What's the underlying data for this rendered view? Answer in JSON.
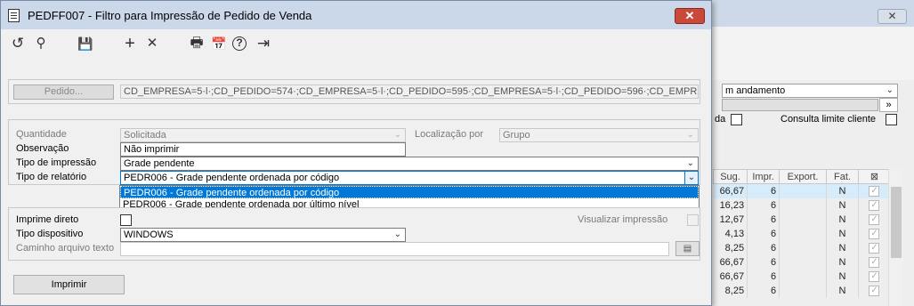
{
  "window": {
    "title": "PEDFF007 - Filtro para Impressão de Pedido de Venda",
    "close_glyph": "✕"
  },
  "toolbar": {
    "icons": [
      "undo-icon",
      "search-icon",
      "save-icon",
      "add-icon",
      "delete-icon",
      "print-icon",
      "calendar-icon",
      "help-icon",
      "exit-icon"
    ],
    "glyphs": [
      "↺",
      "⚲",
      "💾",
      "+",
      "✕",
      "🖶",
      "📅",
      "?",
      "⇥"
    ]
  },
  "pedido": {
    "button_label": "Pedido...",
    "value": "CD_EMPRESA=5·l·;CD_PEDIDO=574·;CD_EMPRESA=5·l·;CD_PEDIDO=595·;CD_EMPRESA=5·l·;CD_PEDIDO=596·;CD_EMPRESA=5·l·;CD"
  },
  "filters": {
    "quantidade_label": "Quantidade",
    "quantidade_value": "Solicitada",
    "localizacao_label": "Localização por",
    "localizacao_value": "Grupo",
    "observacao_label": "Observação",
    "observacao_value": "Não imprimir",
    "tipo_impressao_label": "Tipo de impressão",
    "tipo_impressao_value": "Grade pendente",
    "tipo_relatorio_label": "Tipo de relatório",
    "tipo_relatorio_value": "PEDR006 - Grade pendente ordenada por código",
    "tipo_relatorio_options": [
      "PEDR006 - Grade pendente ordenada por código",
      "PEDR006 - Grade pendente ordenada por último nível"
    ]
  },
  "output": {
    "imprime_direto_label": "Imprime direto",
    "visualizar_label": "Visualizar impressão",
    "tipo_dispositivo_label": "Tipo dispositivo",
    "tipo_dispositivo_value": "WINDOWS",
    "caminho_label": "Caminho arquivo texto",
    "caminho_value": ""
  },
  "actions": {
    "imprimir_label": "Imprimir"
  },
  "background": {
    "close_glyph": "✕",
    "status_select": "m andamento",
    "arrow_button": "»",
    "da_label": "da",
    "consulta_label": "Consulta limite cliente",
    "table_headers": [
      "Sug.",
      "Impr.",
      "Export.",
      "Fat.",
      "⊠"
    ],
    "rows": [
      {
        "sug": "66,67",
        "impr": "6",
        "fat": "N"
      },
      {
        "sug": "16,23",
        "impr": "6",
        "fat": "N"
      },
      {
        "sug": "12,67",
        "impr": "6",
        "fat": "N"
      },
      {
        "sug": "4,13",
        "impr": "6",
        "fat": "N"
      },
      {
        "sug": "8,25",
        "impr": "6",
        "fat": "N"
      },
      {
        "sug": "66,67",
        "impr": "6",
        "fat": "N"
      },
      {
        "sug": "66,67",
        "impr": "6",
        "fat": "N"
      },
      {
        "sug": "8,25",
        "impr": "6",
        "fat": "N"
      }
    ],
    "check_glyph": "✓"
  }
}
